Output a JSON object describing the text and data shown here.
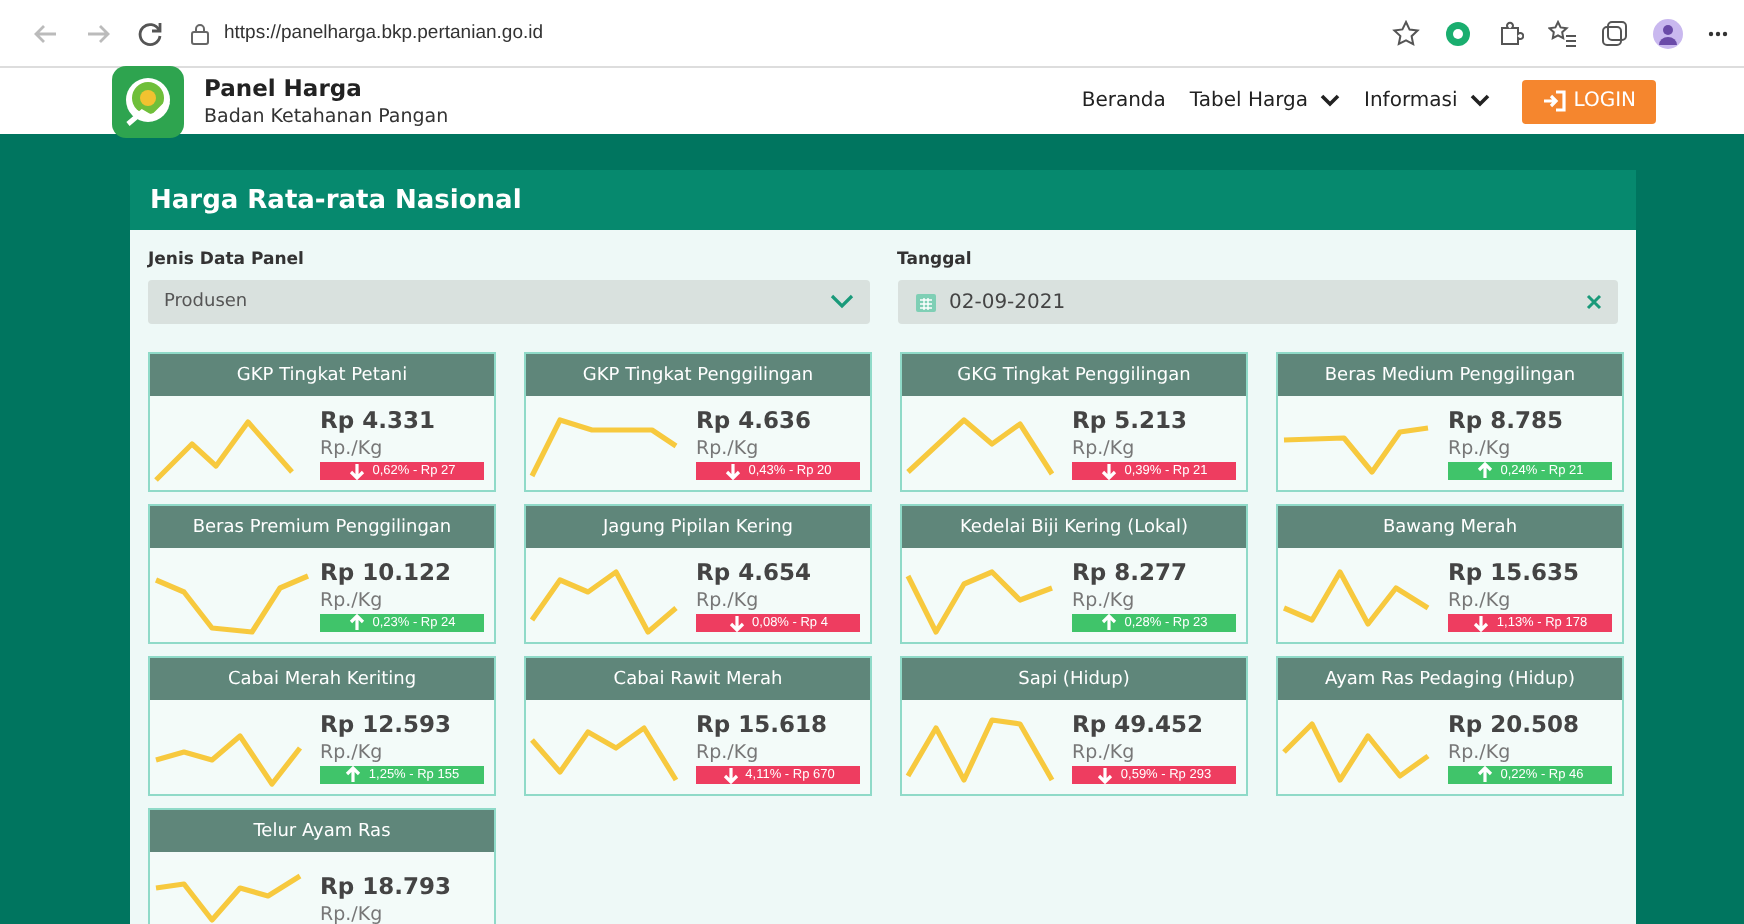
{
  "browser": {
    "url": "https://panelharga.bkp.pertanian.go.id"
  },
  "header": {
    "title": "Panel Harga",
    "subtitle": "Badan Ketahanan Pangan",
    "nav": [
      {
        "label": "Beranda",
        "dropdown": false
      },
      {
        "label": "Tabel Harga",
        "dropdown": true
      },
      {
        "label": "Informasi",
        "dropdown": true
      }
    ],
    "login": "LOGIN"
  },
  "panel": {
    "title": "Harga Rata-rata Nasional",
    "filters": [
      {
        "kind": "select",
        "label": "Jenis Data Panel",
        "value": "Produsen"
      },
      {
        "kind": "date",
        "label": "Tanggal",
        "value": "02-09-2021"
      }
    ],
    "cards": [
      {
        "name": "GKP Tingkat Petani",
        "price": "Rp 4.331",
        "unit": "Rp./Kg",
        "kind": "down",
        "change": "0,62% - Rp 27"
      },
      {
        "name": "GKP Tingkat Penggilingan",
        "price": "Rp 4.636",
        "unit": "Rp./Kg",
        "kind": "down",
        "change": "0,43% - Rp 20"
      },
      {
        "name": "GKG Tingkat Penggilingan",
        "price": "Rp 5.213",
        "unit": "Rp./Kg",
        "kind": "down",
        "change": "0,39% - Rp 21"
      },
      {
        "name": "Beras Medium Penggilingan",
        "price": "Rp 8.785",
        "unit": "Rp./Kg",
        "kind": "up",
        "change": "0,24% - Rp 21"
      },
      {
        "name": "Beras Premium Penggilingan",
        "price": "Rp 10.122",
        "unit": "Rp./Kg",
        "kind": "up",
        "change": "0,23% - Rp 24"
      },
      {
        "name": "Jagung Pipilan Kering",
        "price": "Rp 4.654",
        "unit": "Rp./Kg",
        "kind": "down",
        "change": "0,08% - Rp 4"
      },
      {
        "name": "Kedelai Biji Kering (Lokal)",
        "price": "Rp 8.277",
        "unit": "Rp./Kg",
        "kind": "up",
        "change": "0,28% - Rp 23"
      },
      {
        "name": "Bawang Merah",
        "price": "Rp 15.635",
        "unit": "Rp./Kg",
        "kind": "down",
        "change": "1,13% - Rp 178"
      },
      {
        "name": "Cabai Merah Keriting",
        "price": "Rp 12.593",
        "unit": "Rp./Kg",
        "kind": "up",
        "change": "1,25% - Rp 155"
      },
      {
        "name": "Cabai Rawit Merah",
        "price": "Rp 15.618",
        "unit": "Rp./Kg",
        "kind": "down",
        "change": "4,11% - Rp 670"
      },
      {
        "name": "Sapi (Hidup)",
        "price": "Rp 49.452",
        "unit": "Rp./Kg",
        "kind": "down",
        "change": "0,59% - Rp 293"
      },
      {
        "name": "Ayam Ras Pedaging (Hidup)",
        "price": "Rp 20.508",
        "unit": "Rp./Kg",
        "kind": "up",
        "change": "0,22% - Rp 46"
      },
      {
        "name": "Telur Ayam Ras",
        "price": "Rp 18.793",
        "unit": "Rp./Kg"
      }
    ]
  }
}
